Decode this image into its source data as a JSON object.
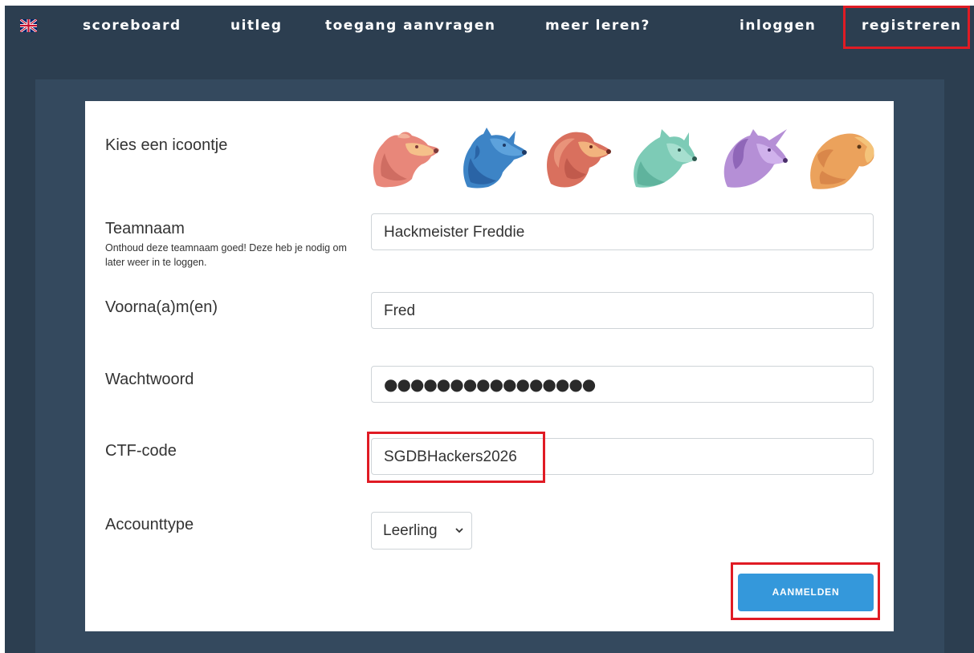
{
  "nav": {
    "items": [
      {
        "label": "scoreboard"
      },
      {
        "label": "uitleg"
      },
      {
        "label": "toegang aanvragen"
      },
      {
        "label": "meer leren?"
      },
      {
        "label": "inloggen"
      },
      {
        "label": "registreren",
        "active": true
      }
    ],
    "language_icon": "uk-flag-icon"
  },
  "form": {
    "icon_label": "Kies een icoontje",
    "icons": [
      "bear-icon",
      "wolf-icon",
      "lion-icon",
      "cat-icon",
      "unicorn-icon",
      "eagle-icon"
    ],
    "team_name": {
      "label": "Teamnaam",
      "hint": "Onthoud deze teamnaam goed! Deze heb je nodig om later weer in te loggen.",
      "value": "Hackmeister Freddie"
    },
    "first_names": {
      "label": "Voorna(a)m(en)",
      "value": "Fred"
    },
    "password": {
      "label": "Wachtwoord",
      "masked": "●●●●●●●●●●●●●●●●"
    },
    "ctf_code": {
      "label": "CTF-code",
      "value": "SGDBHackers2026"
    },
    "account_type": {
      "label": "Accounttype",
      "selected": "Leerling"
    },
    "submit_label": "AANMELDEN"
  },
  "colors": {
    "nav_bg": "#2c3e50",
    "panel_bg": "#34495e",
    "button": "#3498db",
    "highlight": "#e01b24",
    "bear": "#e8877a",
    "wolf": "#3d84c6",
    "lion": "#d9705e",
    "cat": "#7dcbb6",
    "unicorn": "#b58fd6",
    "eagle": "#eba25c"
  }
}
